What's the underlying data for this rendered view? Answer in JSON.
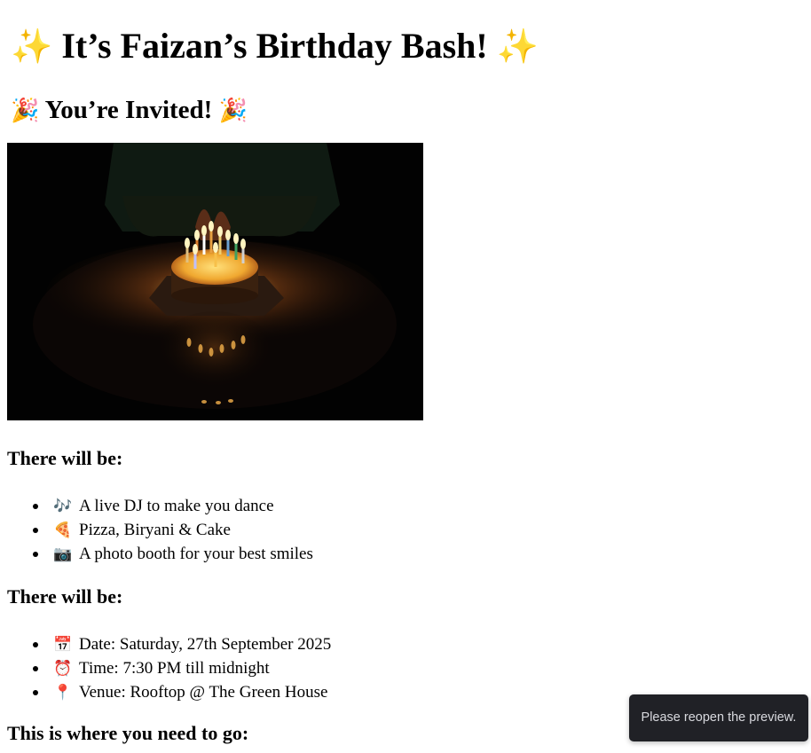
{
  "header": {
    "title_emoji": "✨",
    "title": "It’s Faizan’s Birthday Bash!",
    "subtitle_emoji": "🎉",
    "subtitle": "You’re Invited!"
  },
  "photo": {
    "description_icon": "birthday-cake-photo"
  },
  "activities": {
    "heading": "There will be:",
    "items": [
      {
        "icon": "🎶",
        "text": "A live DJ to make you dance"
      },
      {
        "icon": "🍕",
        "text": "Pizza, Biryani & Cake"
      },
      {
        "icon": "📷",
        "text": "A photo booth for your best smiles"
      }
    ]
  },
  "details": {
    "heading": "There will be:",
    "items": [
      {
        "icon": "📅",
        "text": "Date: Saturday, 27th September 2025"
      },
      {
        "icon": "⏰",
        "text": "Time: 7:30 PM till midnight"
      },
      {
        "icon": "📍",
        "text": "Venue: Rooftop @ The Green House"
      }
    ]
  },
  "directions": {
    "heading": "This is where you need to go:"
  },
  "toast": {
    "message": "Please reopen the preview."
  },
  "colors": {
    "toast_bg": "#202126",
    "toast_text": "#d8d9de",
    "sparkle": "#f5b324"
  }
}
